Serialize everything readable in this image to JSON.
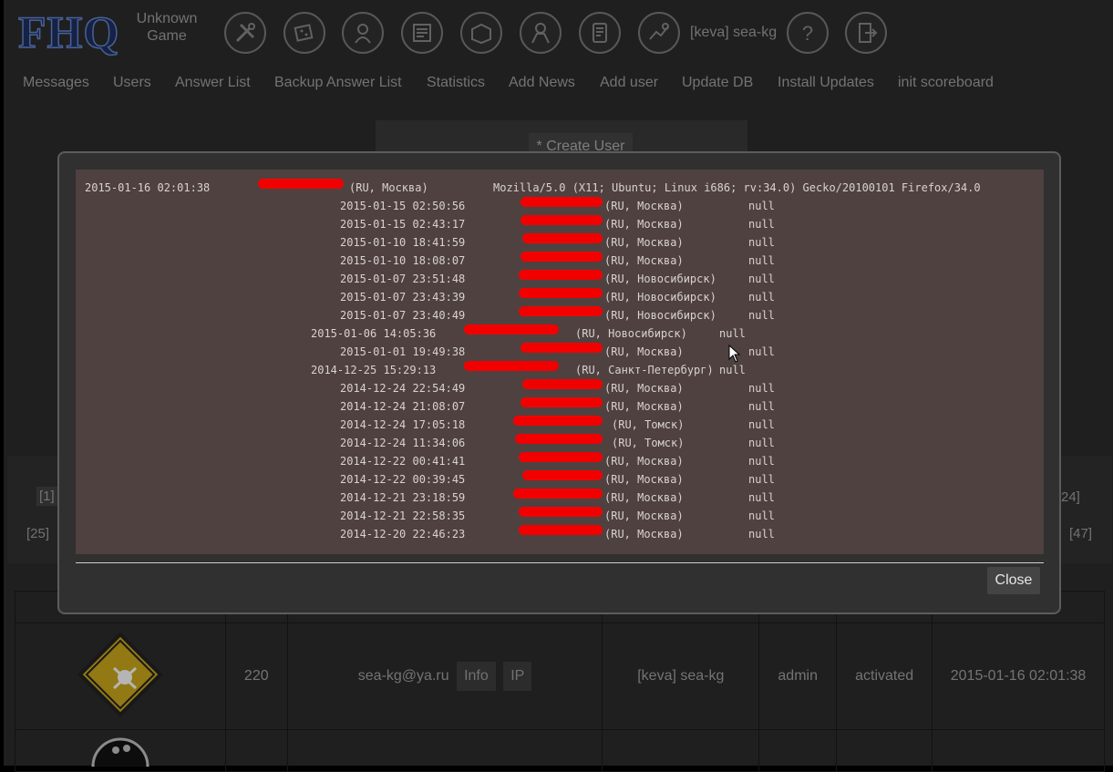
{
  "header": {
    "logo": "FHQ",
    "game_line1": "Unknown",
    "game_line2": "Game",
    "user": "[keva] sea-kg",
    "icons": [
      "tools-icon",
      "dice-icon",
      "quest-icon",
      "news-icon",
      "box-icon",
      "person-icon",
      "scroll-icon",
      "feedback-icon",
      "help-icon",
      "exit-icon"
    ]
  },
  "menu": [
    "Messages",
    "Users",
    "Answer List",
    "Backup Answer List",
    "Statistics",
    "Add News",
    "Add user",
    "Update DB",
    "Install Updates",
    "init scoreboard"
  ],
  "create_user": "* Create User",
  "pager": {
    "first": "[1]",
    "right_top": "24]",
    "left_bottom": "[25]",
    "right_bottom": "[47]"
  },
  "table": {
    "row1": {
      "id": "220",
      "email": "sea-kg@ya.ru",
      "info": "Info",
      "ip": "IP",
      "nick": "[keva] sea-kg",
      "role": "admin",
      "status": "activated",
      "date": "2015-01-16 02:01:38"
    }
  },
  "modal": {
    "first": {
      "date": "2015-01-16 02:01:38",
      "loc": "(RU, Москва)",
      "agent": "Mozilla/5.0 (X11; Ubuntu; Linux i686; rv:34.0) Gecko/20100101 Firefox/34.0"
    },
    "rows": [
      {
        "date": "2015-01-15 02:50:56",
        "loc": "(RU, Москва)",
        "agent": "null"
      },
      {
        "date": "2015-01-15 02:43:17",
        "loc": "(RU, Москва)",
        "agent": "null"
      },
      {
        "date": "2015-01-10 18:41:59",
        "loc": "(RU, Москва)",
        "agent": "null"
      },
      {
        "date": "2015-01-10 18:08:07",
        "loc": "(RU, Москва)",
        "agent": "null"
      },
      {
        "date": "2015-01-07 23:51:48",
        "loc": "(RU, Новосибирск)",
        "agent": "null"
      },
      {
        "date": "2015-01-07 23:43:39",
        "loc": "(RU, Новосибирск)",
        "agent": "null"
      },
      {
        "date": "2015-01-07 23:40:49",
        "loc": "(RU, Новосибирск)",
        "agent": "null"
      },
      {
        "date": "2015-01-06 14:05:36",
        "loc": "(RU, Новосибирск)",
        "agent": "null"
      },
      {
        "date": "2015-01-01 19:49:38",
        "loc": "(RU, Москва)",
        "agent": "null"
      },
      {
        "date": "2014-12-25 15:29:13",
        "loc": "(RU, Санкт-Петербург)",
        "agent": "null"
      },
      {
        "date": "2014-12-24 22:54:49",
        "loc": "(RU, Москва)",
        "agent": "null"
      },
      {
        "date": "2014-12-24 21:08:07",
        "loc": "(RU, Москва)",
        "agent": "null"
      },
      {
        "date": "2014-12-24 17:05:18",
        "loc": "(RU, Томск)",
        "agent": "null"
      },
      {
        "date": "2014-12-24 11:34:06",
        "loc": "(RU, Томск)",
        "agent": "null"
      },
      {
        "date": "2014-12-22 00:41:41",
        "loc": "(RU, Москва)",
        "agent": "null"
      },
      {
        "date": "2014-12-22 00:39:45",
        "loc": "(RU, Москва)",
        "agent": "null"
      },
      {
        "date": "2014-12-21 23:18:59",
        "loc": "(RU, Москва)",
        "agent": "null"
      },
      {
        "date": "2014-12-21 22:58:35",
        "loc": "(RU, Москва)",
        "agent": "null"
      },
      {
        "date": "2014-12-20 22:46:23",
        "loc": "(RU, Москва)",
        "agent": "null"
      }
    ],
    "close": "Close"
  },
  "colors": {
    "redact": "#f20000",
    "log_bg": "#4f4140",
    "logo_fill": "#1a2a55",
    "logo_stroke": "#5a77b6"
  }
}
